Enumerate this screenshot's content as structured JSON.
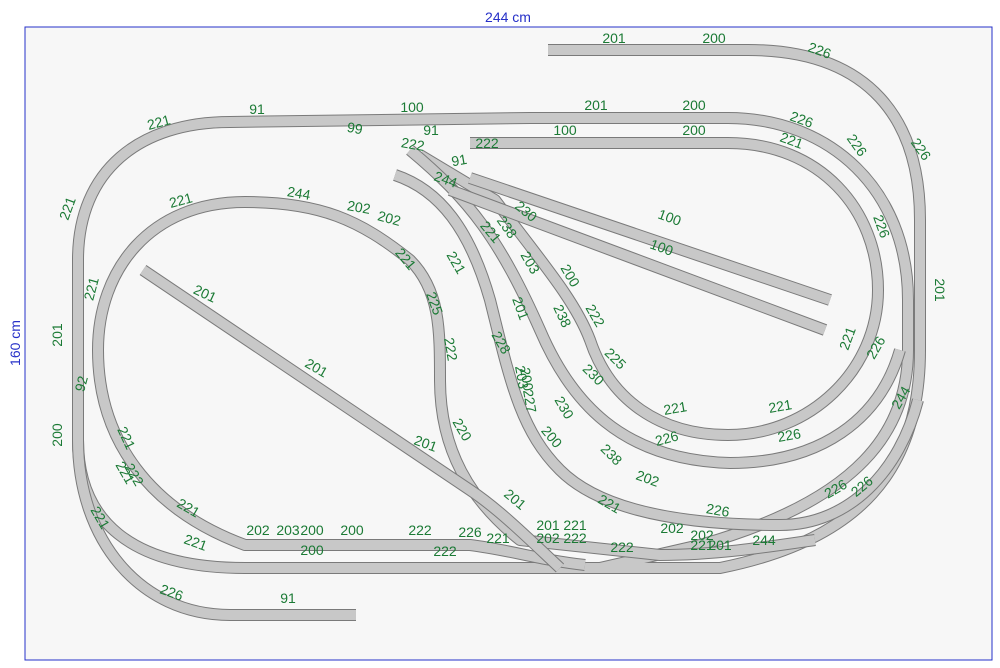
{
  "plan": {
    "width_label": "244 cm",
    "height_label": "160 cm",
    "colors": {
      "border": "#2630c8",
      "track_label": "#1b7a35",
      "track_outer": "#7a7a7a",
      "track_fill": "#c8c8c8",
      "board": "#f7f7f7"
    }
  },
  "track_labels": [
    "201",
    "200",
    "226",
    "226",
    "226",
    "201",
    "244",
    "226",
    "226",
    "221",
    "91",
    "100",
    "201",
    "200",
    "226",
    "221",
    "221",
    "221",
    "226",
    "226",
    "99",
    "91",
    "100",
    "200",
    "222",
    "222",
    "91",
    "244",
    "230",
    "100",
    "100",
    "221",
    "221",
    "201",
    "221",
    "201",
    "92",
    "200",
    "221",
    "221",
    "221",
    "201",
    "244",
    "202",
    "202",
    "221",
    "225",
    "222",
    "220",
    "221",
    "238",
    "228",
    "200",
    "203",
    "200",
    "222",
    "201",
    "238",
    "225",
    "230",
    "221",
    "221",
    "200",
    "203",
    "227",
    "230",
    "238",
    "202",
    "221",
    "226",
    "226",
    "226",
    "202",
    "202",
    "244",
    "201",
    "201",
    "221",
    "221",
    "200",
    "222",
    "226",
    "221",
    "226",
    "222",
    "202",
    "203",
    "200",
    "200",
    "222",
    "202",
    "222",
    "222",
    "91",
    "201",
    "221",
    "221",
    "201",
    "201"
  ]
}
